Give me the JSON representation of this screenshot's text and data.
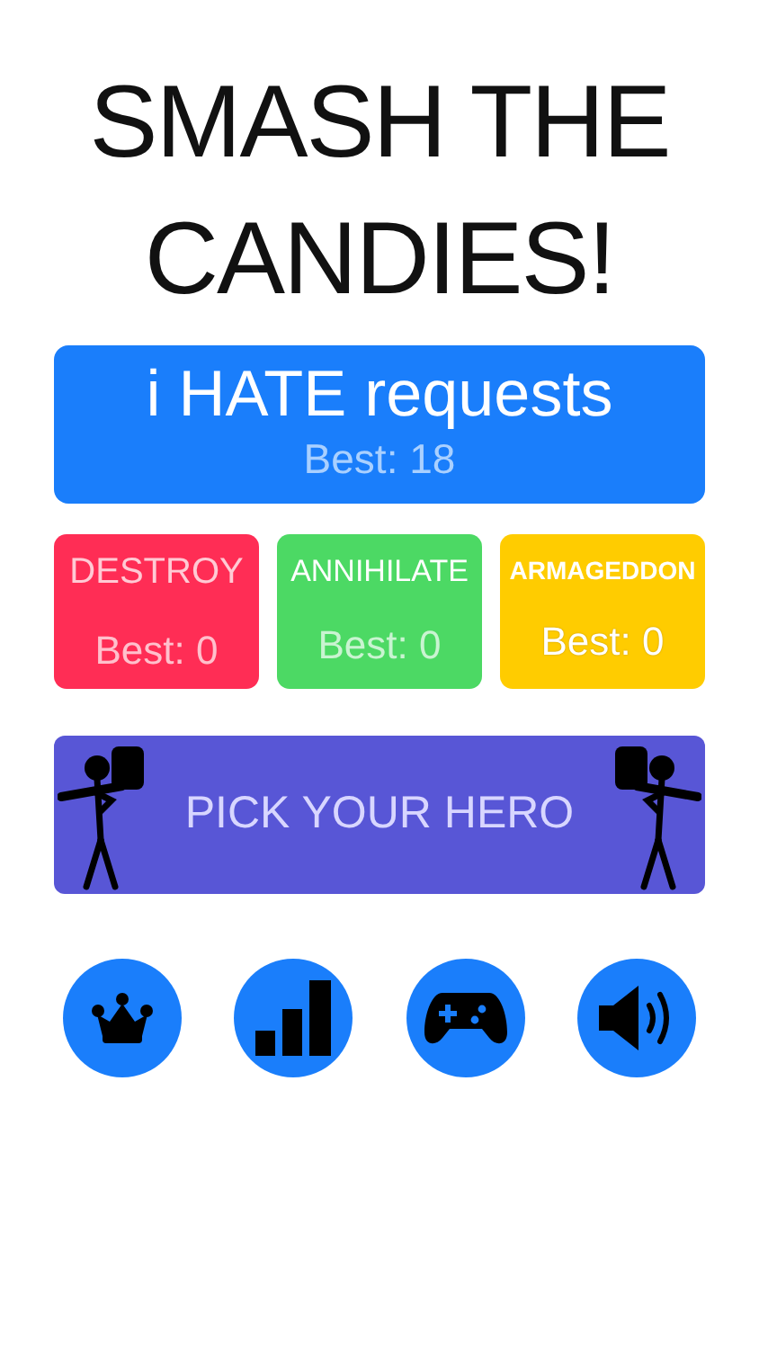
{
  "title_lines": [
    "SMASH THE",
    "CANDIES!"
  ],
  "main_mode": {
    "title": "i HATE requests",
    "best": "Best: 18"
  },
  "modes": [
    {
      "title": "DESTROY",
      "best": "Best: 0",
      "color": "#ff2d55"
    },
    {
      "title": "ANNIHILATE",
      "best": "Best: 0",
      "color": "#4cd964"
    },
    {
      "title": "ARMAGEDDON",
      "best": "Best: 0",
      "color": "#ffcc00"
    }
  ],
  "hero_button": {
    "label": "PICK YOUR HERO"
  }
}
